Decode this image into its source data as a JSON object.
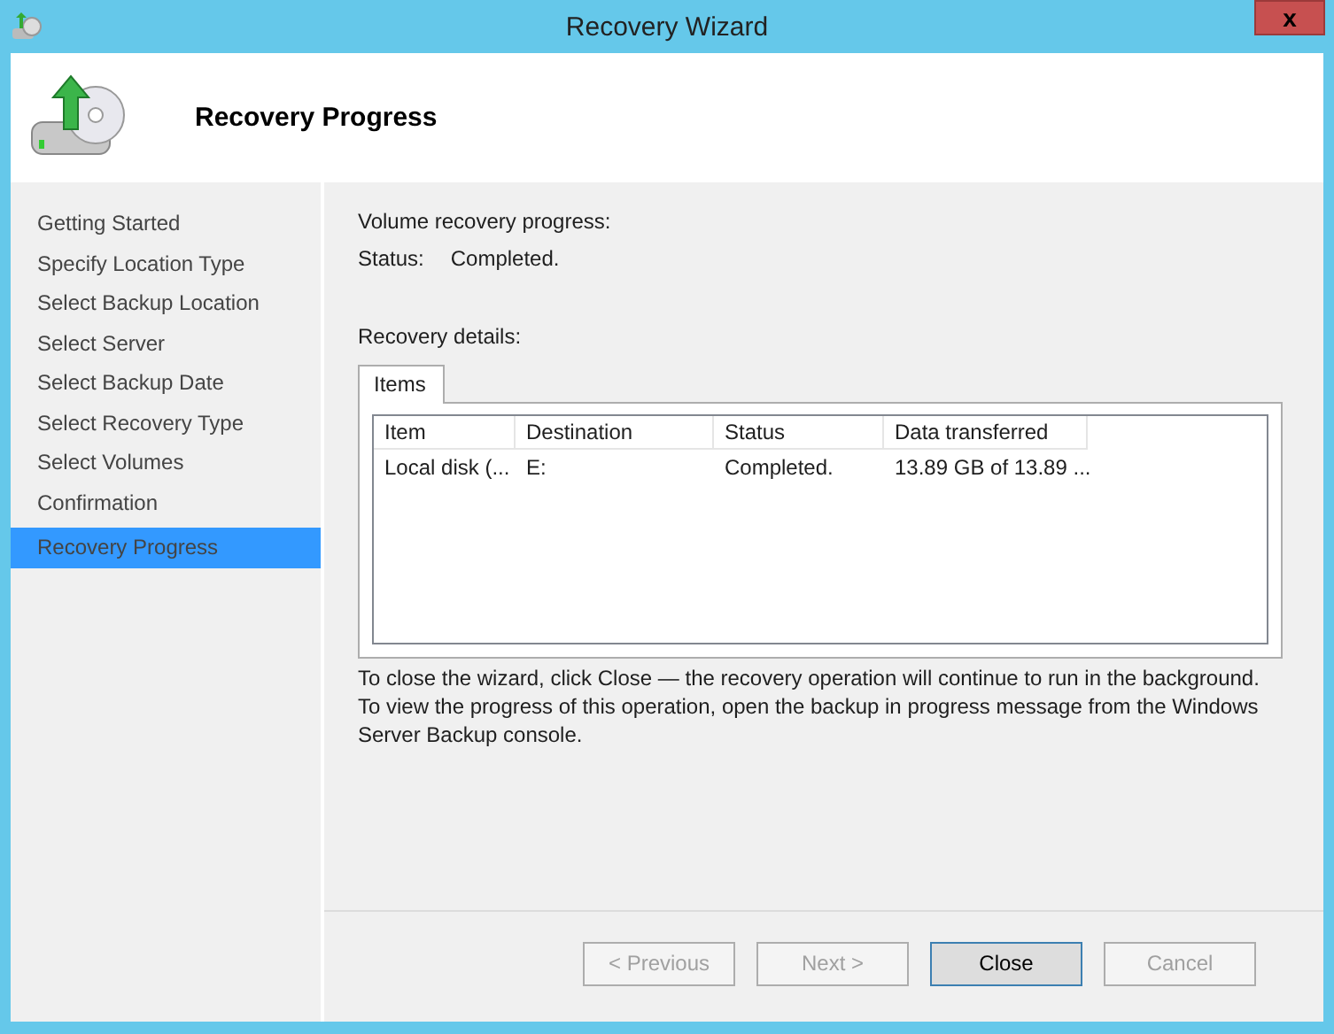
{
  "window": {
    "title": "Recovery Wizard",
    "close_label": "x"
  },
  "header": {
    "title": "Recovery Progress"
  },
  "steps": [
    {
      "label": "Getting Started",
      "selected": false
    },
    {
      "label": "Specify Location Type",
      "selected": false
    },
    {
      "label": "Select Backup Location",
      "selected": false
    },
    {
      "label": "Select Server",
      "selected": false
    },
    {
      "label": "Select Backup Date",
      "selected": false
    },
    {
      "label": "Select Recovery Type",
      "selected": false
    },
    {
      "label": "Select Volumes",
      "selected": false
    },
    {
      "label": "Confirmation",
      "selected": false
    },
    {
      "label": "Recovery Progress",
      "selected": true
    }
  ],
  "progress": {
    "heading": "Volume recovery progress:",
    "status_label": "Status:",
    "status_value": "Completed."
  },
  "details": {
    "heading": "Recovery details:",
    "tabs": [
      {
        "label": "Items",
        "selected": true
      }
    ],
    "table": {
      "columns": [
        "Item",
        "Destination",
        "Status",
        "Data transferred"
      ],
      "rows": [
        [
          "Local disk (...",
          "E:",
          "Completed.",
          "13.89 GB of 13.89 ..."
        ]
      ]
    }
  },
  "note": [
    "To close the wizard, click Close — the recovery operation will continue to run in the background.",
    "To view the progress of this operation, open the backup in progress message from the Windows Server Backup console."
  ],
  "buttons": [
    {
      "label": "< Previous",
      "disabled": true,
      "default": false
    },
    {
      "label": "Next >",
      "disabled": true,
      "default": false
    },
    {
      "label": "Close",
      "disabled": false,
      "default": true
    },
    {
      "label": "Cancel",
      "disabled": true,
      "default": false
    }
  ]
}
